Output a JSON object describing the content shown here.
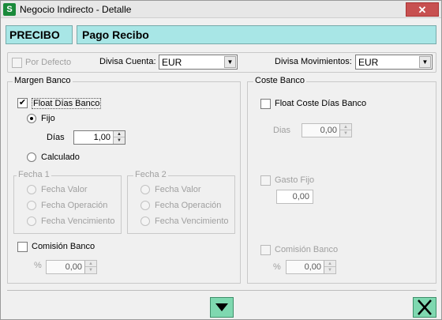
{
  "window": {
    "title": "Negocio Indirecto - Detalle",
    "close_glyph": "✕"
  },
  "header": {
    "code": "PRECIBO",
    "name": "Pago Recibo"
  },
  "options": {
    "por_defecto_label": "Por Defecto",
    "divisa_cuenta_label": "Divisa Cuenta:",
    "divisa_cuenta_value": "EUR",
    "divisa_mov_label": "Divisa Movimientos:",
    "divisa_mov_value": "EUR"
  },
  "margen": {
    "title": "Margen Banco",
    "float_label": "Float Días Banco",
    "fijo_label": "Fijo",
    "dias_label": "Días",
    "dias_value": "1,00",
    "calculado_label": "Calculado",
    "fecha1": {
      "title": "Fecha 1",
      "opt1": "Fecha Valor",
      "opt2": "Fecha Operación",
      "opt3": "Fecha Vencimiento"
    },
    "fecha2": {
      "title": "Fecha 2",
      "opt1": "Fecha Valor",
      "opt2": "Fecha Operación",
      "opt3": "Fecha Vencimiento"
    },
    "comision_label": "Comisión Banco",
    "pct_label": "%",
    "pct_value": "0,00"
  },
  "coste": {
    "title": "Coste Banco",
    "float_label": "Float Coste Días Banco",
    "dias_label": "Dias",
    "dias_value": "0,00",
    "gasto_label": "Gasto Fijo",
    "gasto_value": "0,00",
    "comision_label": "Comisión Banco",
    "pct_label": "%",
    "pct_value": "0,00"
  },
  "icons": {
    "app": "app-logo-icon",
    "down": "down-arrow-icon",
    "close": "close-icon"
  }
}
